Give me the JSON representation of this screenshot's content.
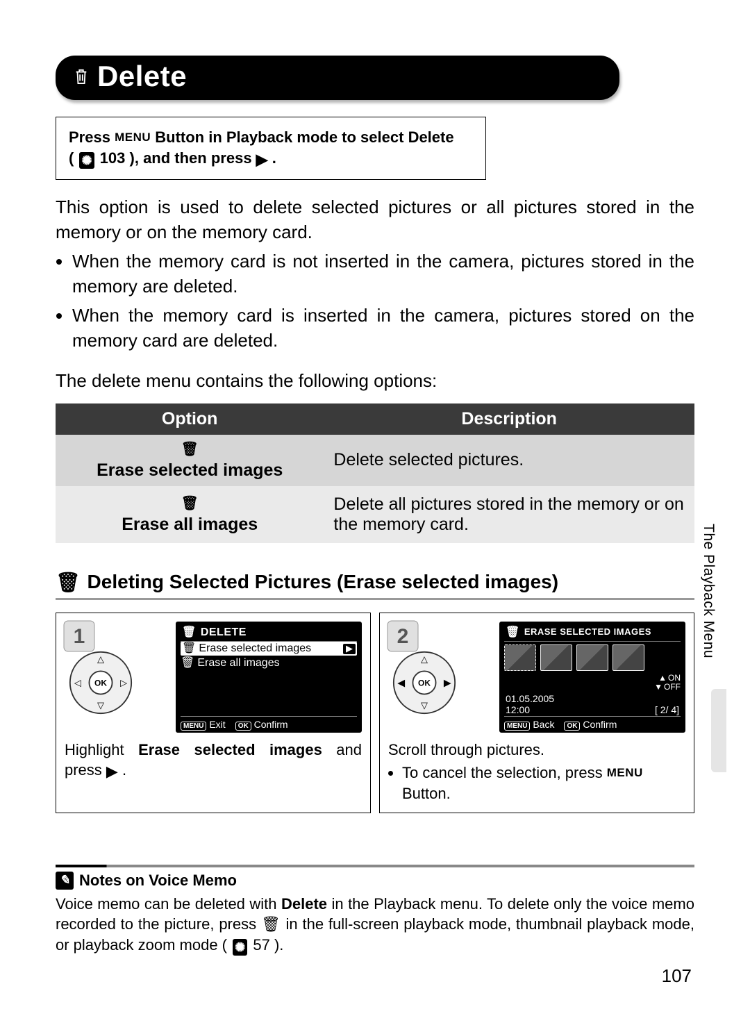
{
  "header": {
    "icon": "trash-icon",
    "title": "Delete"
  },
  "instruction": {
    "line1_a": "Press ",
    "menu_key": "MENU",
    "line1_b": " Button in Playback mode to select ",
    "bold": "Delete",
    "line2_a": "(",
    "ref_icon": "☙",
    "ref_num": "103",
    "line2_b": "), and then press ",
    "arrow": "▶",
    "line2_c": "."
  },
  "body": {
    "intro": "This option is used to delete selected pictures or all pictures stored in the memory or on the memory card.",
    "bullets": [
      "When the memory card is not inserted in the camera, pictures stored in the memory are deleted.",
      "When the memory card is inserted in the camera, pictures stored on the memory card are deleted."
    ],
    "table_intro": "The delete menu contains the following options:"
  },
  "table": {
    "head": {
      "option": "Option",
      "description": "Description"
    },
    "rows": [
      {
        "icon": "🗑",
        "label": "Erase selected images",
        "desc": "Delete selected pictures."
      },
      {
        "icon": "🗑",
        "label": "Erase all images",
        "desc": "Delete all pictures stored in the memory or on the memory card."
      }
    ]
  },
  "section": {
    "icon": "🗑",
    "title": "Deleting Selected Pictures (Erase selected images)"
  },
  "step1": {
    "lcd_title": "DELETE",
    "row1": "Erase selected images",
    "row2": "Erase all images",
    "footer_exit": "Exit",
    "footer_confirm": "Confirm",
    "caption_a": "Highlight ",
    "caption_bold": "Erase  selected  images",
    "caption_b": " and press ",
    "arrow": "▶",
    "caption_c": "."
  },
  "step2": {
    "lcd_title": "ERASE SELECTED IMAGES",
    "on": "ON",
    "off": "OFF",
    "date": "01.05.2005",
    "time": "12:00",
    "count": "[     2/     4]",
    "footer_back": "Back",
    "footer_confirm": "Confirm",
    "caption": "Scroll through pictures.",
    "bullet_a": "To cancel the selection, press ",
    "menu_key": "MENU",
    "bullet_b": " Button."
  },
  "side_label": "The Playback Menu",
  "notes": {
    "heading": "Notes on Voice Memo",
    "body_a": "Voice memo can be deleted with ",
    "body_bold": "Delete",
    "body_b": " in the Playback menu. To delete only the voice memo recorded to the picture, press ",
    "trash": "🗑",
    "body_c": " in the full-screen playback mode, thumbnail playback mode, or playback zoom mode ( ",
    "ref_num": "57",
    "body_d": ")."
  },
  "page_number": "107"
}
